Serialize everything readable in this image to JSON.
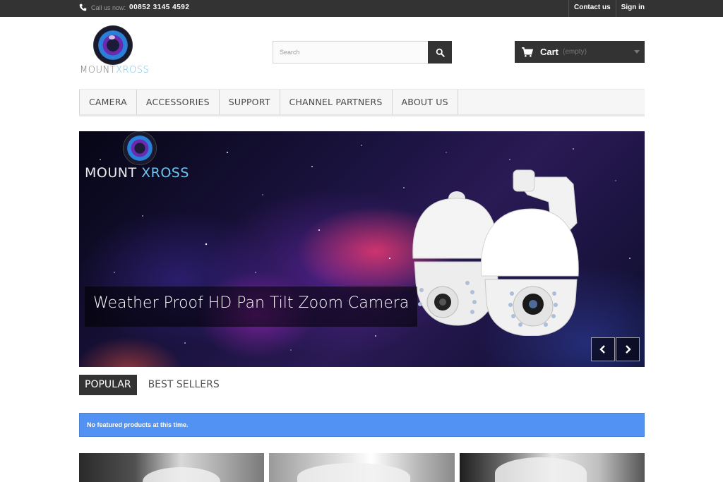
{
  "topbar": {
    "call_label": "Call us now:",
    "phone": "00852 3145 4592",
    "links": [
      "Contact us",
      "Sign in"
    ]
  },
  "brand": {
    "logo_text_a": "MOUNT",
    "logo_text_b": "XROSS"
  },
  "search": {
    "placeholder": "Search"
  },
  "cart": {
    "label": "Cart",
    "status": "(empty)"
  },
  "nav": {
    "items": [
      "CAMERA",
      "ACCESSORIES",
      "SUPPORT",
      "CHANNEL PARTNERS",
      "ABOUT US"
    ]
  },
  "slider": {
    "logo_text_a": "MOUNT ",
    "logo_text_b": "XROSS",
    "caption": "Weather Proof HD Pan Tilt Zoom Camera"
  },
  "tabs": [
    "POPULAR",
    "BEST SELLERS"
  ],
  "alert": "No featured products at this time.",
  "colors": {
    "topbar": "#333333",
    "alert": "#5192f3",
    "accent": "#6ec3ef"
  }
}
